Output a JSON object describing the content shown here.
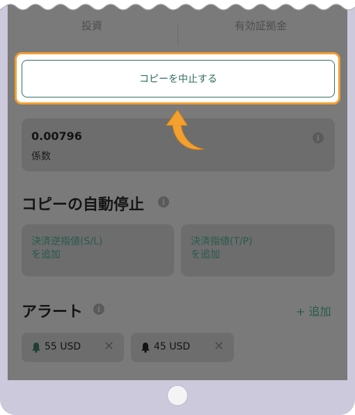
{
  "tabs": [
    "投資",
    "有効証拠金"
  ],
  "stop_copy_button": "コピーを中止する",
  "coefficient": {
    "value": "0.00796",
    "label": "係数"
  },
  "auto_stop": {
    "title": "コピーの自動停止",
    "stop_loss": [
      "決済逆指値(S/L)",
      "を追加"
    ],
    "take_profit": [
      "決済指値(T/P)",
      "を追加"
    ]
  },
  "alerts": {
    "title": "アラート",
    "add_label": "+ 追加",
    "items": [
      {
        "label": "55 USD",
        "bell_color": "#1f3f33"
      },
      {
        "label": "45 USD",
        "bell_color": "#141414"
      }
    ]
  },
  "icons": {
    "info": "i",
    "close": "✕"
  },
  "colors": {
    "accent_green": "#2f6d5e",
    "highlight_orange": "#f3a030",
    "overlay_gray": "#7a7a7a"
  }
}
